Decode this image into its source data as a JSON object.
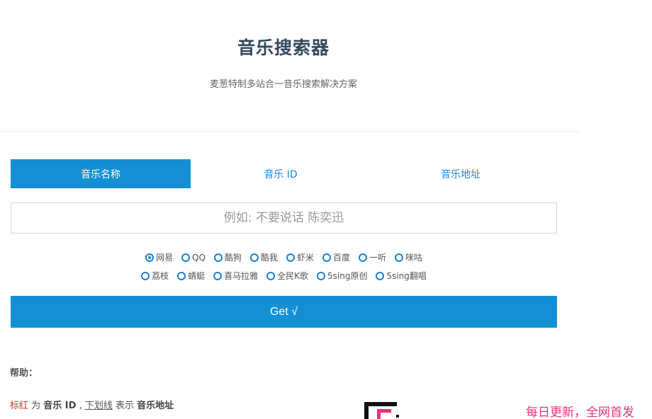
{
  "header": {
    "title": "音乐搜索器",
    "subtitle": "麦葱特制多站合一音乐搜索解决方案"
  },
  "tabs": [
    {
      "label": "音乐名称",
      "active": true
    },
    {
      "label": "音乐 ID",
      "active": false
    },
    {
      "label": "音乐地址",
      "active": false
    }
  ],
  "search": {
    "placeholder": "例如: 不要说话 陈奕迅",
    "value": ""
  },
  "sources": {
    "row1": [
      {
        "label": "网易",
        "checked": true
      },
      {
        "label": "QQ",
        "checked": false
      },
      {
        "label": "酷狗",
        "checked": false
      },
      {
        "label": "酷我",
        "checked": false
      },
      {
        "label": "虾米",
        "checked": false
      },
      {
        "label": "百度",
        "checked": false
      },
      {
        "label": "一听",
        "checked": false
      },
      {
        "label": "咪咕",
        "checked": false
      }
    ],
    "row2": [
      {
        "label": "荔枝",
        "checked": false
      },
      {
        "label": "蜻蜓",
        "checked": false
      },
      {
        "label": "喜马拉雅",
        "checked": false
      },
      {
        "label": "全民K歌",
        "checked": false
      },
      {
        "label": "5sing原创",
        "checked": false
      },
      {
        "label": "5sing翻唱",
        "checked": false
      }
    ]
  },
  "submit": {
    "label": "Get √"
  },
  "help": {
    "title": "帮助：",
    "red_text": "标红",
    "t1": " 为 ",
    "id_text": "音乐 ID",
    "t2": " , ",
    "underline_text": "下划线",
    "t3": " 表示 ",
    "url_text": "音乐地址"
  },
  "promo": {
    "text": "每日更新，全网首发"
  },
  "colors": {
    "accent": "#1390d4",
    "title": "#34495e",
    "promo": "#e8327c",
    "red": "#d2322d"
  }
}
